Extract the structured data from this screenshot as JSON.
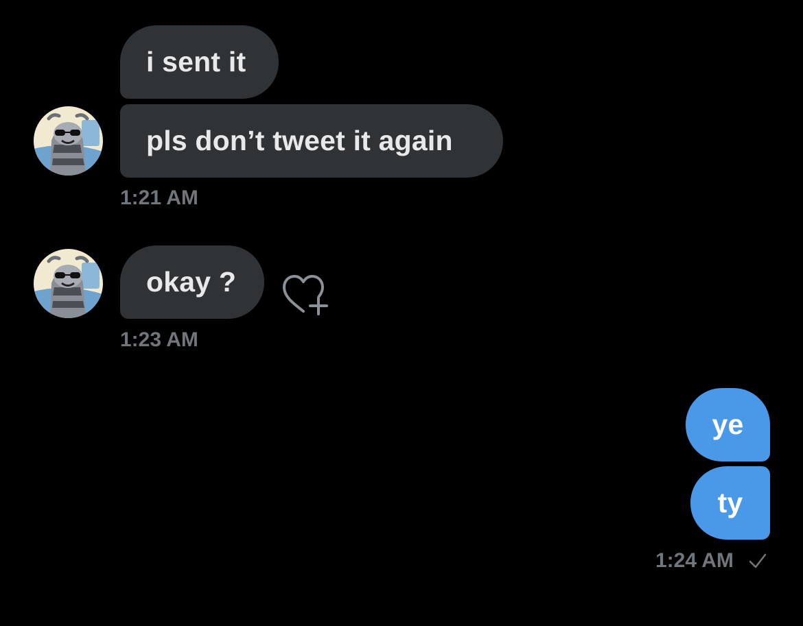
{
  "conversation": {
    "groups": [
      {
        "sender": "them",
        "messages": [
          {
            "text": "i sent it"
          },
          {
            "text": "pls don’t tweet it again"
          }
        ],
        "timestamp": "1:21 AM"
      },
      {
        "sender": "them",
        "messages": [
          {
            "text": "okay ?"
          }
        ],
        "timestamp": "1:23 AM"
      },
      {
        "sender": "me",
        "messages": [
          {
            "text": "ye"
          },
          {
            "text": "ty"
          }
        ],
        "timestamp": "1:24 AM"
      }
    ]
  },
  "icons": {
    "avatar": "raccoon-avatar-icon",
    "reaction": "add-reaction-heart-icon",
    "read_receipt": "checkmark-icon"
  },
  "colors": {
    "background": "#000000",
    "incoming_bubble": "#2f3336",
    "incoming_text": "#e7e9ea",
    "outgoing_bubble": "#4a99e9",
    "outgoing_text": "#ffffff",
    "timestamp": "#71767b"
  }
}
